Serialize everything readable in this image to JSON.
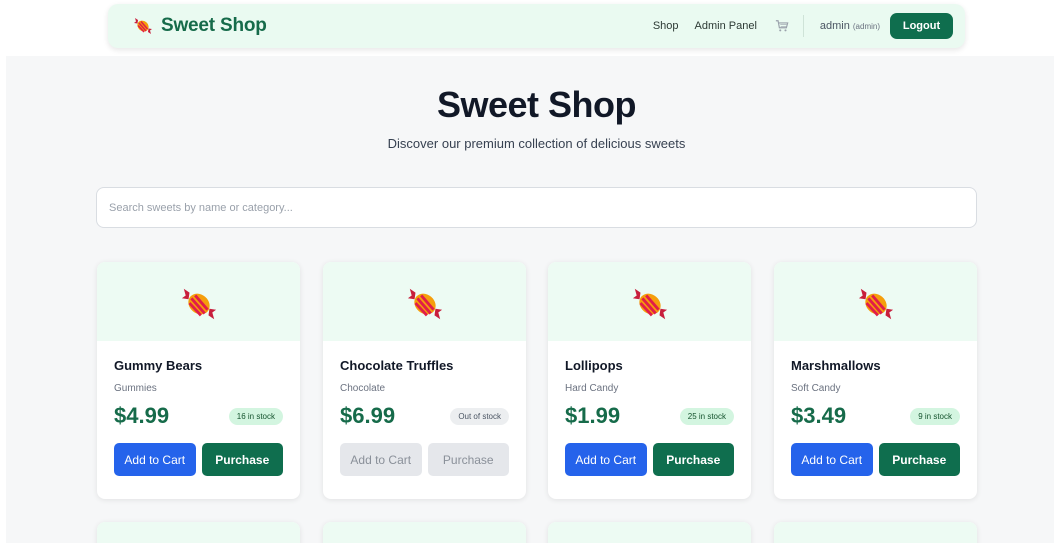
{
  "nav": {
    "brand": "Sweet Shop",
    "links": [
      "Shop",
      "Admin Panel"
    ],
    "user_name": "admin",
    "user_role": "(admin)",
    "logout_label": "Logout",
    "icons": {
      "brand": "candy-icon",
      "cart": "cart-icon"
    }
  },
  "hero": {
    "title": "Sweet Shop",
    "subtitle": "Discover our premium collection of delicious sweets"
  },
  "search": {
    "placeholder": "Search sweets by name or category...",
    "value": ""
  },
  "products": [
    {
      "name": "Gummy Bears",
      "category": "Gummies",
      "price": "$4.99",
      "stock": "16 in stock",
      "in_stock": true,
      "add_label": "Add to Cart",
      "buy_label": "Purchase"
    },
    {
      "name": "Chocolate Truffles",
      "category": "Chocolate",
      "price": "$6.99",
      "stock": "Out of stock",
      "in_stock": false,
      "add_label": "Add to Cart",
      "buy_label": "Purchase"
    },
    {
      "name": "Lollipops",
      "category": "Hard Candy",
      "price": "$1.99",
      "stock": "25 in stock",
      "in_stock": true,
      "add_label": "Add to Cart",
      "buy_label": "Purchase"
    },
    {
      "name": "Marshmallows",
      "category": "Soft Candy",
      "price": "$3.49",
      "stock": "9 in stock",
      "in_stock": true,
      "add_label": "Add to Cart",
      "buy_label": "Purchase"
    }
  ],
  "colors": {
    "brand": "#166b4a",
    "primary_blue": "#2563eb",
    "success_green": "#0f6e4e",
    "media_bg": "#edfbf3"
  }
}
